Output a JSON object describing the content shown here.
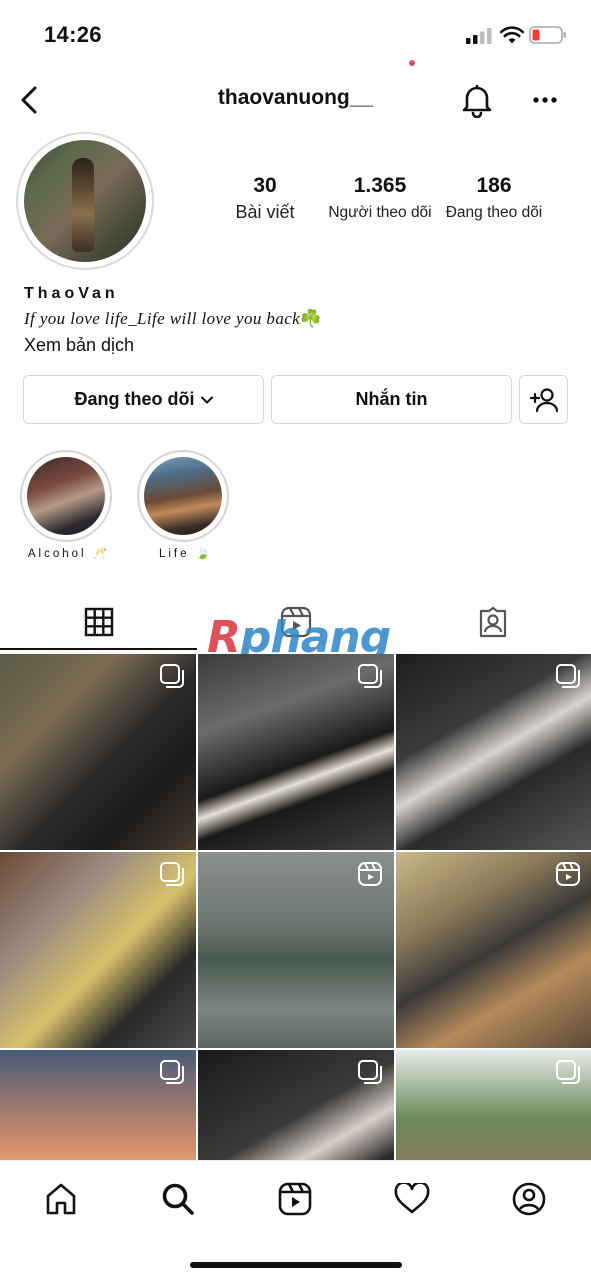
{
  "status_bar": {
    "time": "14:26"
  },
  "header": {
    "username": "thaovanuong__"
  },
  "profile": {
    "stats": [
      {
        "value": "30",
        "label": "Bài viết"
      },
      {
        "value": "1.365",
        "label": "Người theo dõi"
      },
      {
        "value": "186",
        "label": "Đang theo dõi"
      }
    ],
    "display_name": "ThaoVan",
    "bio": "If you love life_Life will love you back",
    "bio_emoji": "☘️",
    "translate_link": "Xem bản dịch"
  },
  "actions": {
    "following_label": "Đang theo dõi",
    "message_label": "Nhắn tin"
  },
  "highlights": [
    {
      "label": "Alcohol 🥂"
    },
    {
      "label": "Life 🍃"
    }
  ],
  "watermark": {
    "prefix": "R",
    "text": "phang"
  },
  "grid_posts": [
    {
      "type": "multiple"
    },
    {
      "type": "multiple"
    },
    {
      "type": "multiple"
    },
    {
      "type": "multiple"
    },
    {
      "type": "reel"
    },
    {
      "type": "reel"
    },
    {
      "type": "multiple"
    },
    {
      "type": "multiple"
    },
    {
      "type": "multiple"
    }
  ],
  "colors": {
    "notification": "#ed4956",
    "watermark_blue": "#2f86c9",
    "watermark_red": "#d7343a"
  },
  "icons": {
    "back": "chevron-left-icon",
    "bell": "bell-icon",
    "more": "more-horizontal-icon",
    "add_user": "add-user-icon",
    "grid": "grid-icon",
    "reels": "reels-icon",
    "tagged": "tagged-icon",
    "home": "home-icon",
    "search": "search-icon",
    "activity": "heart-icon",
    "profile": "profile-icon"
  }
}
